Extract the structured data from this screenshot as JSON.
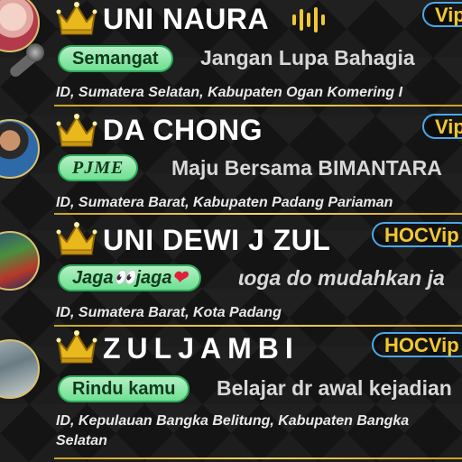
{
  "rows": [
    {
      "name": "UNI  NAURA",
      "tag": "Vip",
      "badge": "Semangat",
      "slogan": "Jangan Lupa Bahagia",
      "location": "ID, Sumatera Selatan, Kabupaten Ogan Komering I"
    },
    {
      "name": "DA CHONG",
      "tag": "Vip",
      "badge": "PJME",
      "slogan": "Maju Bersama BIMANTARA",
      "location": "ID, Sumatera Barat, Kabupaten Padang Pariaman"
    },
    {
      "name": "UNI DEWI J ZUL",
      "tag": "HOCVip",
      "badge_prefix": "Jaga",
      "badge_eyes": "👀",
      "badge_suffix": "jaga",
      "badge_heart": "❤",
      "slogan": "ɩoga do mudahkan ja",
      "location": "ID, Sumatera Barat, Kota Padang"
    },
    {
      "name": "ZULJAMBI",
      "tag": "HOCVip",
      "badge": "Rindu kamu",
      "slogan": "Belajar dr awal kejadian",
      "location": "ID, Kepulauan Bangka Belitung, Kabupaten Bangka Selatan"
    }
  ],
  "icons": {
    "crown": "crown-icon",
    "sound": "sound-wave-icon",
    "mic": "microphone-icon"
  },
  "colors": {
    "gold": "#f2c830",
    "vip_border": "#4aa8e8",
    "badge_green": "#6ee092",
    "divider_gold": "#d4af37"
  }
}
